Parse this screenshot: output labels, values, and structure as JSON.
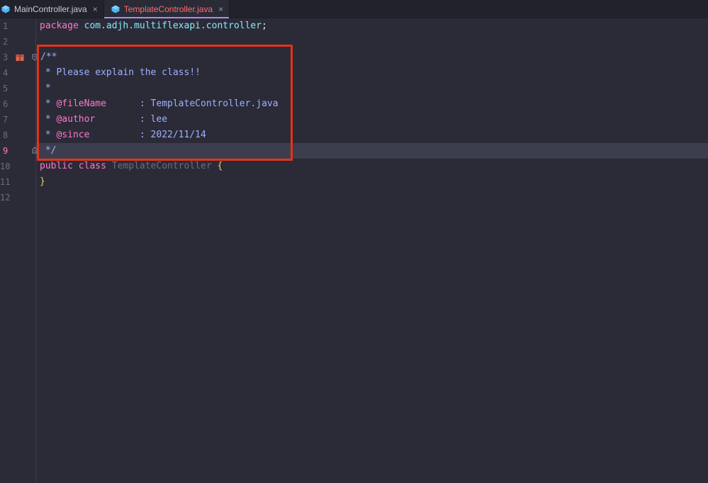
{
  "tabs": [
    {
      "label": "MainController.java",
      "close": "×",
      "active": false
    },
    {
      "label": "TemplateController.java",
      "close": "×",
      "active": true
    }
  ],
  "gutter": {
    "line_numbers": [
      "1",
      "2",
      "3",
      "4",
      "5",
      "6",
      "7",
      "8",
      "9",
      "10",
      "11",
      "12"
    ],
    "current_line": "9"
  },
  "code": {
    "l1": {
      "kw": "package",
      "pkg": "com.adjh.multiflexapi.controller",
      "semi": ";"
    },
    "l3": {
      "text": "/**"
    },
    "l4": {
      "text": " * Please explain the class!!"
    },
    "l5": {
      "text": " *"
    },
    "l6": {
      "star": " * ",
      "tag": "@fileName",
      "rest": "      : TemplateController.java"
    },
    "l7": {
      "star": " * ",
      "tag": "@author",
      "rest": "        : lee"
    },
    "l8": {
      "star": " * ",
      "tag": "@since",
      "rest": "         : 2022/11/14"
    },
    "l9": {
      "text": " */"
    },
    "l10": {
      "kw1": "public",
      "kw2": "class",
      "cls": "TemplateController",
      "brace": "{"
    },
    "l11": {
      "brace": "}"
    }
  },
  "colors": {
    "background": "#2a2b37",
    "keyword": "#ff79c6",
    "comment": "#a0b0ff",
    "highlight_box": "#e8311a"
  },
  "icons": {
    "tab_file": "java-class-icon",
    "bookmark": "bookmark-icon",
    "fold": "fold-icon"
  }
}
